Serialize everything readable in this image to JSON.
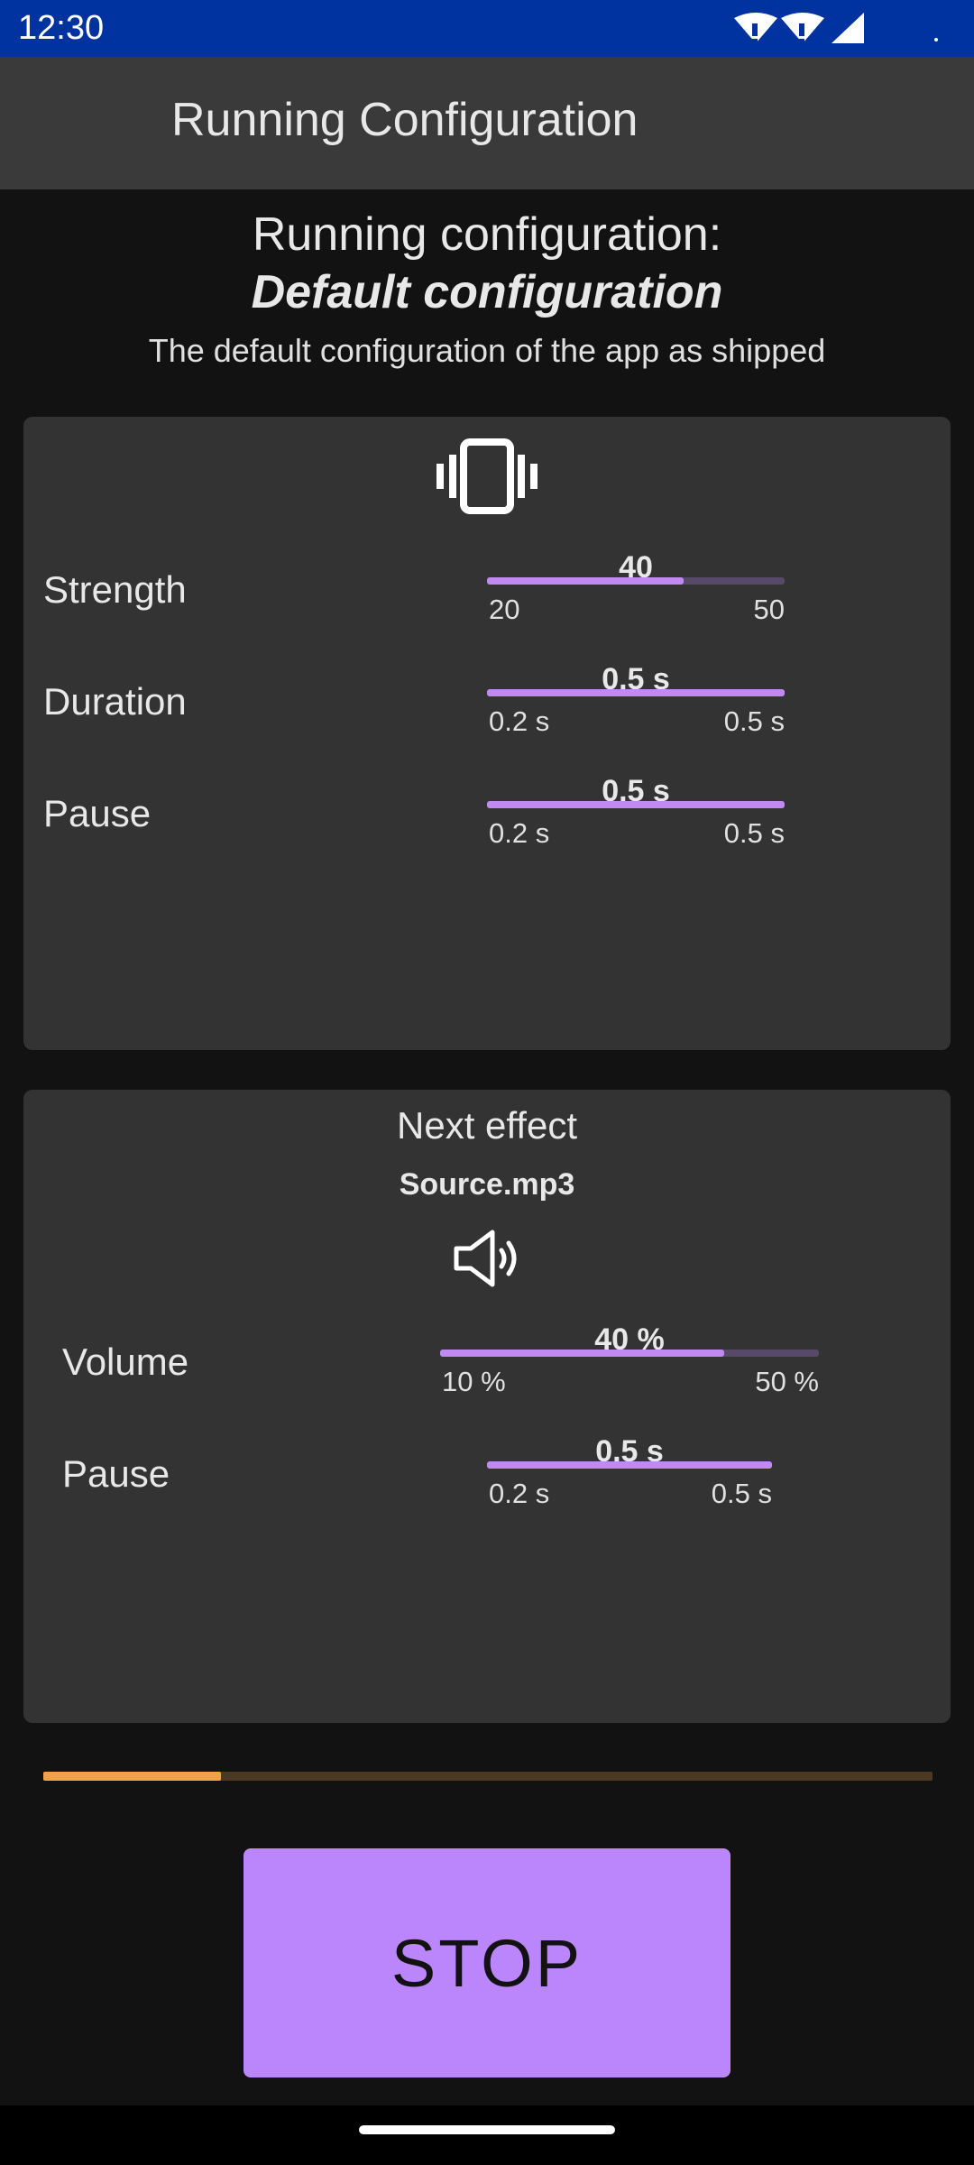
{
  "status_bar": {
    "time": "12:30",
    "icons": [
      "wifi-alert-icon",
      "wifi-alert-icon",
      "signal-icon"
    ]
  },
  "app_bar": {
    "title": "Running Configuration"
  },
  "header": {
    "heading": "Running configuration:",
    "config_name": "Default configuration",
    "description": "The default configuration of the app as shipped"
  },
  "vibration_card": {
    "icon": "vibration-icon",
    "rows": [
      {
        "label": "Strength",
        "value": "40",
        "min": "20",
        "max": "50",
        "fill": 0.66
      },
      {
        "label": "Duration",
        "value": "0.5 s",
        "min": "0.2 s",
        "max": "0.5 s",
        "fill": 1.0
      },
      {
        "label": "Pause",
        "value": "0.5 s",
        "min": "0.2 s",
        "max": "0.5 s",
        "fill": 1.0
      }
    ]
  },
  "sound_card": {
    "title": "Next effect",
    "file": "Source.mp3",
    "icon": "speaker-icon",
    "rows": [
      {
        "label": "Volume",
        "value": "40 %",
        "min": "10 %",
        "max": "50 %",
        "fill": 0.75
      },
      {
        "label": "Pause",
        "value": "0.5 s",
        "min": "0.2 s",
        "max": "0.5 s",
        "fill": 1.0
      }
    ]
  },
  "progress": {
    "fraction": 0.2
  },
  "stop_button": {
    "label": "STOP"
  },
  "colors": {
    "accent": "#bb86fc",
    "progress": "#f3a04a",
    "status_bar": "#0033a0",
    "background": "#121212"
  }
}
